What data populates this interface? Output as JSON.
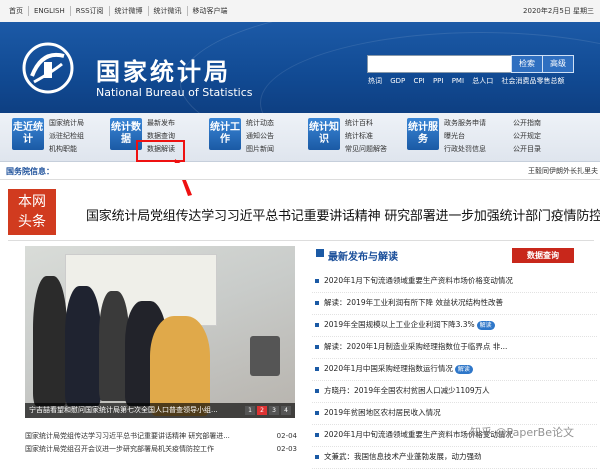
{
  "topbar": {
    "links": [
      "首页",
      "ENGLISH",
      "RSS订阅",
      "统计微博",
      "统计微讯",
      "移动客户端"
    ],
    "date": "2020年2月5日 星期三"
  },
  "banner": {
    "title_cn": "国家统计局",
    "title_en": "National Bureau of Statistics",
    "search_placeholder": "",
    "search_button": "检索",
    "advanced_button": "高级",
    "hot_label": "热词",
    "hot_words": [
      "GDP",
      "CPI",
      "PPI",
      "PMI",
      "总人口",
      "社会消费品零售总额"
    ]
  },
  "nav": [
    {
      "badge": "走近统计",
      "links": [
        "国家统计局",
        "派驻纪检组",
        "机构职能"
      ]
    },
    {
      "badge": "统计数据",
      "links": [
        "最新发布",
        "数据查询",
        "数据解读"
      ]
    },
    {
      "badge": "统计工作",
      "links": [
        "统计动态",
        "通知公告",
        "图片新闻"
      ]
    },
    {
      "badge": "统计知识",
      "links": [
        "统计百科",
        "统计标准",
        "常见问题解答"
      ]
    },
    {
      "badge": "统计服务",
      "links": [
        "政务服务申请",
        "曝光台",
        "行政处罚信息"
      ]
    },
    {
      "badge": "",
      "links": [
        "公开指南",
        "公开规定",
        "公开目录"
      ]
    }
  ],
  "ticker": {
    "label": "国务院信息：",
    "text": "王毅同伊朗外长扎里夫"
  },
  "headline": {
    "badge": "本网头条",
    "text": "国家统计局党组传达学习习近平总书记重要讲话精神 研究部署进一步加强统计部门疫情防控工作"
  },
  "photo": {
    "caption": "宁吉喆看望和慰问国家统计局第七次全国人口普查领导小组...",
    "pages": [
      "1",
      "2",
      "3",
      "4"
    ],
    "active_page": 1
  },
  "left_news": [
    {
      "text": "国家统计局党组传达学习习近平总书记重要讲话精神 研究部署进...",
      "date": "02-04"
    },
    {
      "text": "国家统计局党组召开会议进一步研究部署局机关疫情防控工作",
      "date": "02-03"
    }
  ],
  "releases": {
    "title": "最新发布与解读",
    "query_button": "数据查询",
    "items": [
      {
        "text": "2020年1月下旬流通领域重要生产资料市场价格变动情况",
        "tag": ""
      },
      {
        "text": "解读：2019年工业利润有所下降 效益状况结构性改善",
        "tag": ""
      },
      {
        "text": "2019年全国规模以上工业企业利润下降3.3%",
        "tag": "解读"
      },
      {
        "text": "解读：2020年1月制造业采购经理指数位于临界点 非...",
        "tag": ""
      },
      {
        "text": "2020年1月中国采购经理指数运行情况",
        "tag": "解读"
      },
      {
        "text": "方晓丹：2019年全国农村贫困人口减少1109万人",
        "tag": ""
      },
      {
        "text": "2019年贫困地区农村居民收入情况",
        "tag": ""
      },
      {
        "text": "2020年1月中旬流通领域重要生产资料市场价格变动情况",
        "tag": ""
      },
      {
        "text": "文兼武：我国信息技术产业蓬勃发展，动力强劲",
        "tag": ""
      }
    ]
  },
  "watermark": "知乎 @PaperBe论文",
  "colors": {
    "brand_blue": "#1b5aa5",
    "accent_red": "#d13b1f",
    "highlight_red": "#ee1111"
  }
}
